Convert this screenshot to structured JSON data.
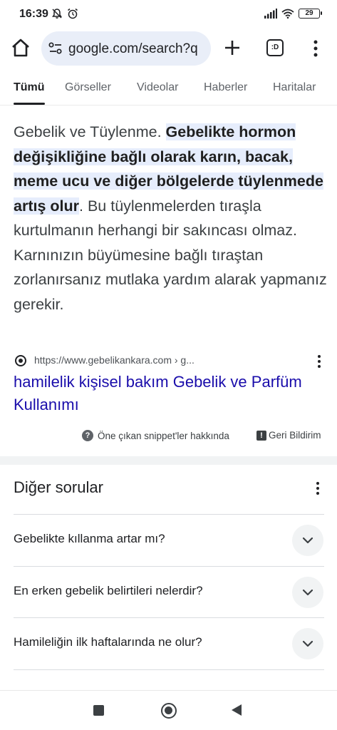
{
  "status_bar": {
    "time": "16:39",
    "battery": "29",
    "icons": [
      "mute-icon",
      "alarm-icon",
      "signal-icon",
      "wifi-icon",
      "battery-icon"
    ]
  },
  "browser": {
    "url": "google.com/search?q",
    "tab_count": ":D",
    "icons": [
      "home-icon",
      "site-settings-icon",
      "add-icon",
      "tab-switcher-icon",
      "more-vert-icon"
    ]
  },
  "search_tabs": {
    "items": [
      {
        "label": "Tümü",
        "active": true
      },
      {
        "label": "Görseller",
        "active": false
      },
      {
        "label": "Videolar",
        "active": false
      },
      {
        "label": "Haberler",
        "active": false
      },
      {
        "label": "Haritalar",
        "active": false
      }
    ]
  },
  "featured_snippet": {
    "text_before": "Gebelik ve Tüylenme. ",
    "highlight": "Gebelikte hormon değişikliğine bağlı olarak karın, bacak, meme ucu ve diğer bölgelerde tüylenmede artış olur",
    "text_after": ". Bu tüylenmelerden tıraşla kurtulmanın herhangi bir sakıncası olmaz. Karnınızın büyümesine bağlı tıraştan zorlanırsanız mutlaka yardım alarak yapmanız gerekir.",
    "source_url": "https://www.gebelikankara.com › g...",
    "result_title": "hamilelik kişisel bakım Gebelik ve Parfüm Kullanımı",
    "about_label": "Öne çıkan snippet'ler hakkında",
    "feedback_label": "Geri Bildirim"
  },
  "related_questions": {
    "title": "Diğer sorular",
    "items": [
      "Gebelikte kıllanma artar mı?",
      "En erken gebelik belirtileri nelerdir?",
      "Hamileliğin ilk haftalarında ne olur?"
    ]
  },
  "colors": {
    "link": "#1a0dab",
    "highlight_bg": "#e6edfc",
    "url_box_bg": "#e9eef8"
  }
}
